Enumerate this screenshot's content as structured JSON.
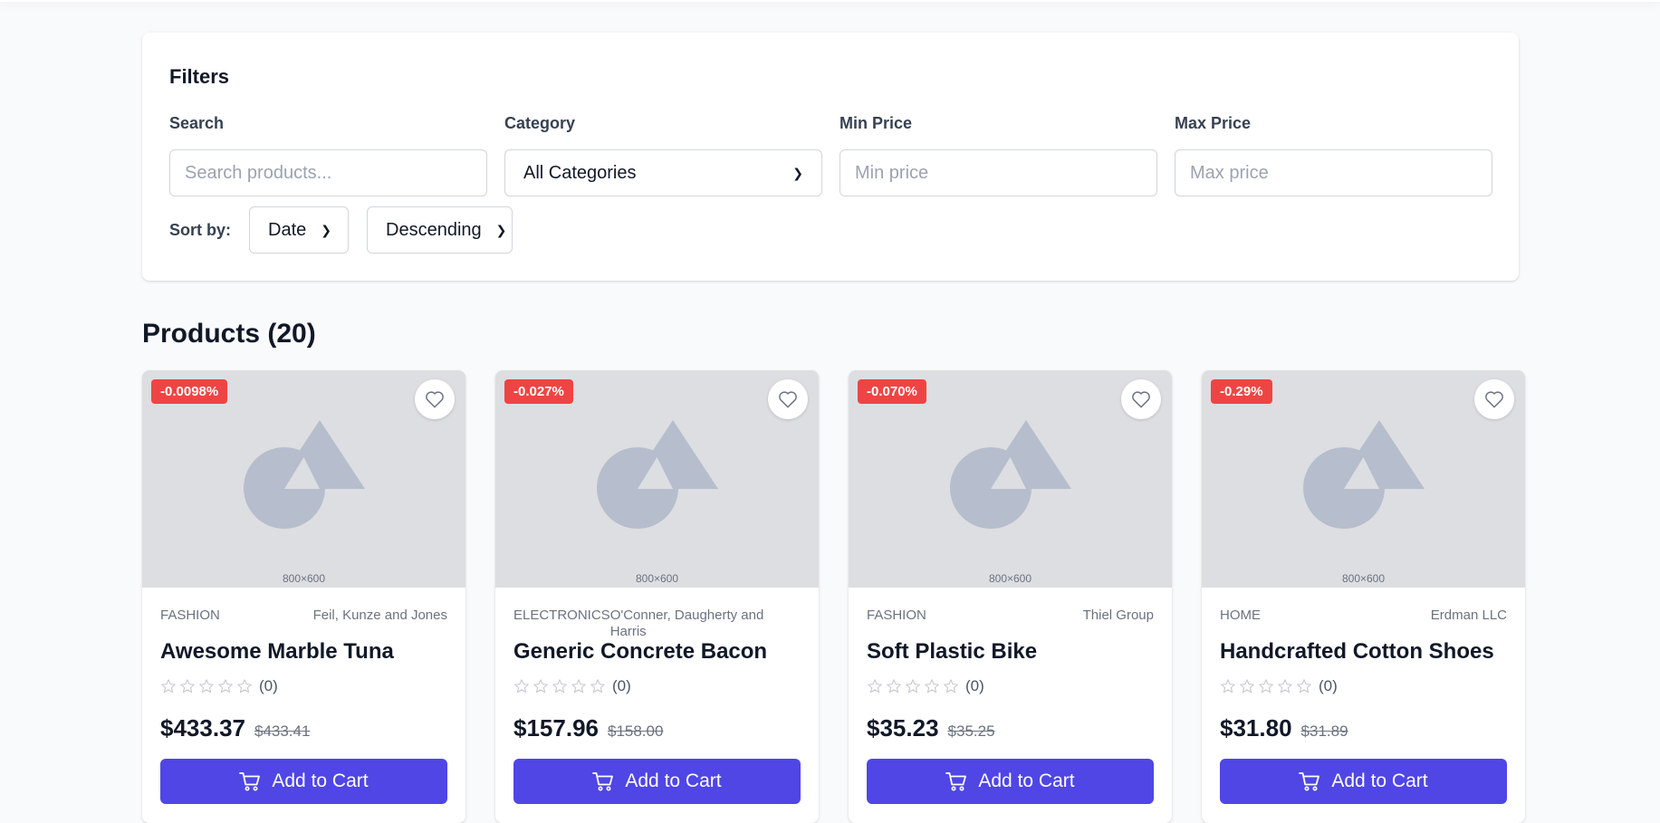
{
  "filters": {
    "title": "Filters",
    "search": {
      "label": "Search",
      "placeholder": "Search products...",
      "value": ""
    },
    "category": {
      "label": "Category",
      "selected": "All Categories"
    },
    "min_price": {
      "label": "Min Price",
      "placeholder": "Min price",
      "value": ""
    },
    "max_price": {
      "label": "Max Price",
      "placeholder": "Max price",
      "value": ""
    },
    "sort": {
      "label": "Sort by:",
      "field": "Date",
      "order": "Descending"
    }
  },
  "products_heading": "Products (20)",
  "colors": {
    "accent": "#4f46e5",
    "discount": "#ef4444",
    "placeholder_bg": "#dddee1"
  },
  "products": [
    {
      "discount": "-0.0098%",
      "image_label": "800×600",
      "category": "FASHION",
      "brand": "Feil, Kunze and Jones",
      "name": "Awesome Marble Tuna",
      "rating_count": "(0)",
      "price": "$433.37",
      "old_price": "$433.41",
      "cta": "Add to Cart"
    },
    {
      "discount": "-0.027%",
      "image_label": "800×600",
      "category": "ELECTRONICS",
      "brand": "O'Conner, Daugherty and Harris",
      "name": "Generic Concrete Bacon",
      "rating_count": "(0)",
      "price": "$157.96",
      "old_price": "$158.00",
      "cta": "Add to Cart"
    },
    {
      "discount": "-0.070%",
      "image_label": "800×600",
      "category": "FASHION",
      "brand": "Thiel Group",
      "name": "Soft Plastic Bike",
      "rating_count": "(0)",
      "price": "$35.23",
      "old_price": "$35.25",
      "cta": "Add to Cart"
    },
    {
      "discount": "-0.29%",
      "image_label": "800×600",
      "category": "HOME",
      "brand": "Erdman LLC",
      "name": "Handcrafted Cotton Shoes",
      "rating_count": "(0)",
      "price": "$31.80",
      "old_price": "$31.89",
      "cta": "Add to Cart"
    }
  ]
}
